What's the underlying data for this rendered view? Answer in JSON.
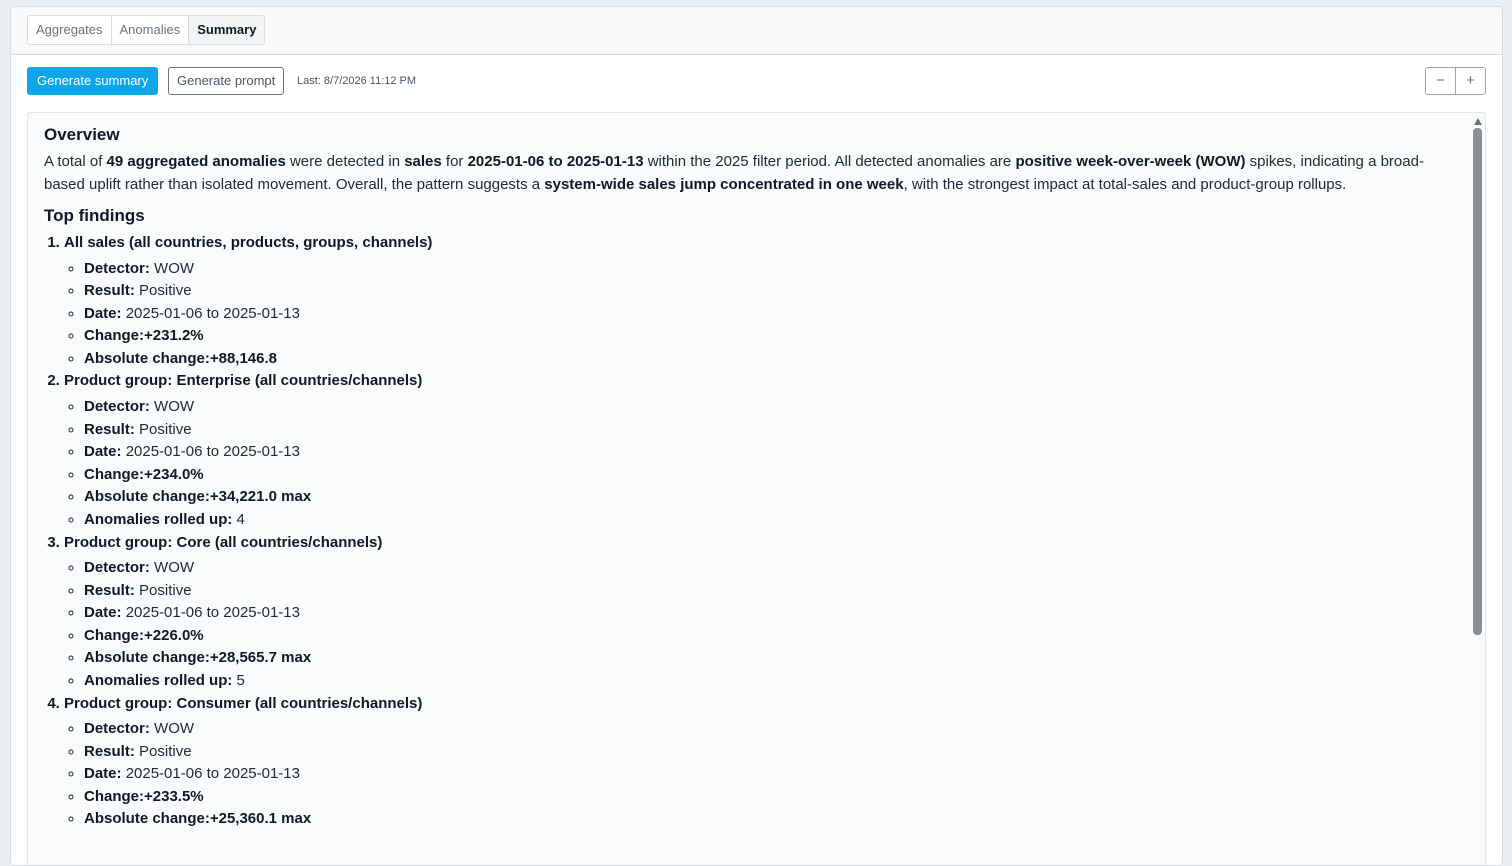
{
  "tabs": [
    "Aggregates",
    "Anomalies",
    "Summary"
  ],
  "active_tab": "Summary",
  "toolbar": {
    "generate_summary_label": "Generate summary",
    "generate_prompt_label": "Generate prompt",
    "last_generated": "Last: 8/7/2026 11:12 PM",
    "zoom_out_label": "−",
    "zoom_in_label": "+"
  },
  "summary": {
    "overview_heading": "Overview",
    "overview": {
      "t1": "A total of ",
      "b1": "49 aggregated anomalies",
      "t2": " were detected in ",
      "b2": "sales",
      "t3": " for ",
      "b3": "2025-01-06 to 2025-01-13",
      "t4": " within the 2025 filter period. All detected anomalies are ",
      "b4": "positive week-over-week (WOW)",
      "t5": " spikes, indicating a broad-based uplift rather than isolated movement. Overall, the pattern suggests a ",
      "b5": "system-wide sales jump concentrated in one week",
      "t6": ", with the strongest impact at total-sales and product-group rollups."
    },
    "findings_heading": "Top findings",
    "findings": [
      {
        "title": "All sales (all countries, products, groups, channels)",
        "detector_label": "Detector:",
        "detector": "WOW",
        "result_label": "Result:",
        "result": "Positive",
        "date_label": "Date:",
        "date": "2025-01-06 to 2025-01-13",
        "change": "Change:+231.2%",
        "abs_change": "Absolute change:+88,146.8"
      },
      {
        "title": "Product group: Enterprise (all countries/channels)",
        "detector_label": "Detector:",
        "detector": "WOW",
        "result_label": "Result:",
        "result": "Positive",
        "date_label": "Date:",
        "date": "2025-01-06 to 2025-01-13",
        "change": "Change:+234.0%",
        "abs_change": "Absolute change:+34,221.0 max",
        "rolled_label": "Anomalies rolled up:",
        "rolled": "4"
      },
      {
        "title": "Product group: Core (all countries/channels)",
        "detector_label": "Detector:",
        "detector": "WOW",
        "result_label": "Result:",
        "result": "Positive",
        "date_label": "Date:",
        "date": "2025-01-06 to 2025-01-13",
        "change": "Change:+226.0%",
        "abs_change": "Absolute change:+28,565.7 max",
        "rolled_label": "Anomalies rolled up:",
        "rolled": "5"
      },
      {
        "title": "Product group: Consumer (all countries/channels)",
        "detector_label": "Detector:",
        "detector": "WOW",
        "result_label": "Result:",
        "result": "Positive",
        "date_label": "Date:",
        "date": "2025-01-06 to 2025-01-13",
        "change": "Change:+233.5%",
        "abs_change": "Absolute change:+25,360.1 max"
      }
    ]
  }
}
